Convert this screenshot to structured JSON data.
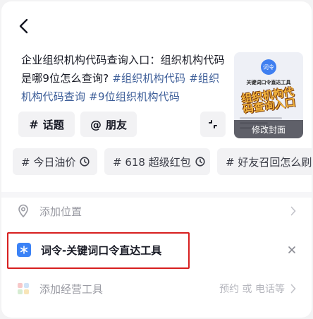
{
  "caption": {
    "text": "企业组织机构代码查询入口：组织机构代码是哪9位怎么查询?",
    "hashtags": [
      "#组织机构代码",
      "#组织机构代码查询",
      "#9位组织机构代码"
    ]
  },
  "chips": {
    "topic": {
      "symbol": "#",
      "label": "话题"
    },
    "friend": {
      "symbol": "@",
      "label": "朋友"
    }
  },
  "cover": {
    "logo_text": "词令",
    "title": "关键词口令直达工具",
    "headline": "组织机构代码查询入口",
    "edit_label": "修改封面"
  },
  "hot_topics": [
    "# 今日油价",
    "# 618 超级红包",
    "# 好友召回怎么刷"
  ],
  "location": {
    "label": "添加位置"
  },
  "tool": {
    "label": "词令-关键词口令直达工具"
  },
  "business": {
    "label": "添加经营工具",
    "hint": "预约 或 电话等"
  },
  "colors": {
    "accent_hashtag": "#3c5d98",
    "highlight_border": "#d71f1f",
    "tool_icon": "#3b82f6"
  }
}
